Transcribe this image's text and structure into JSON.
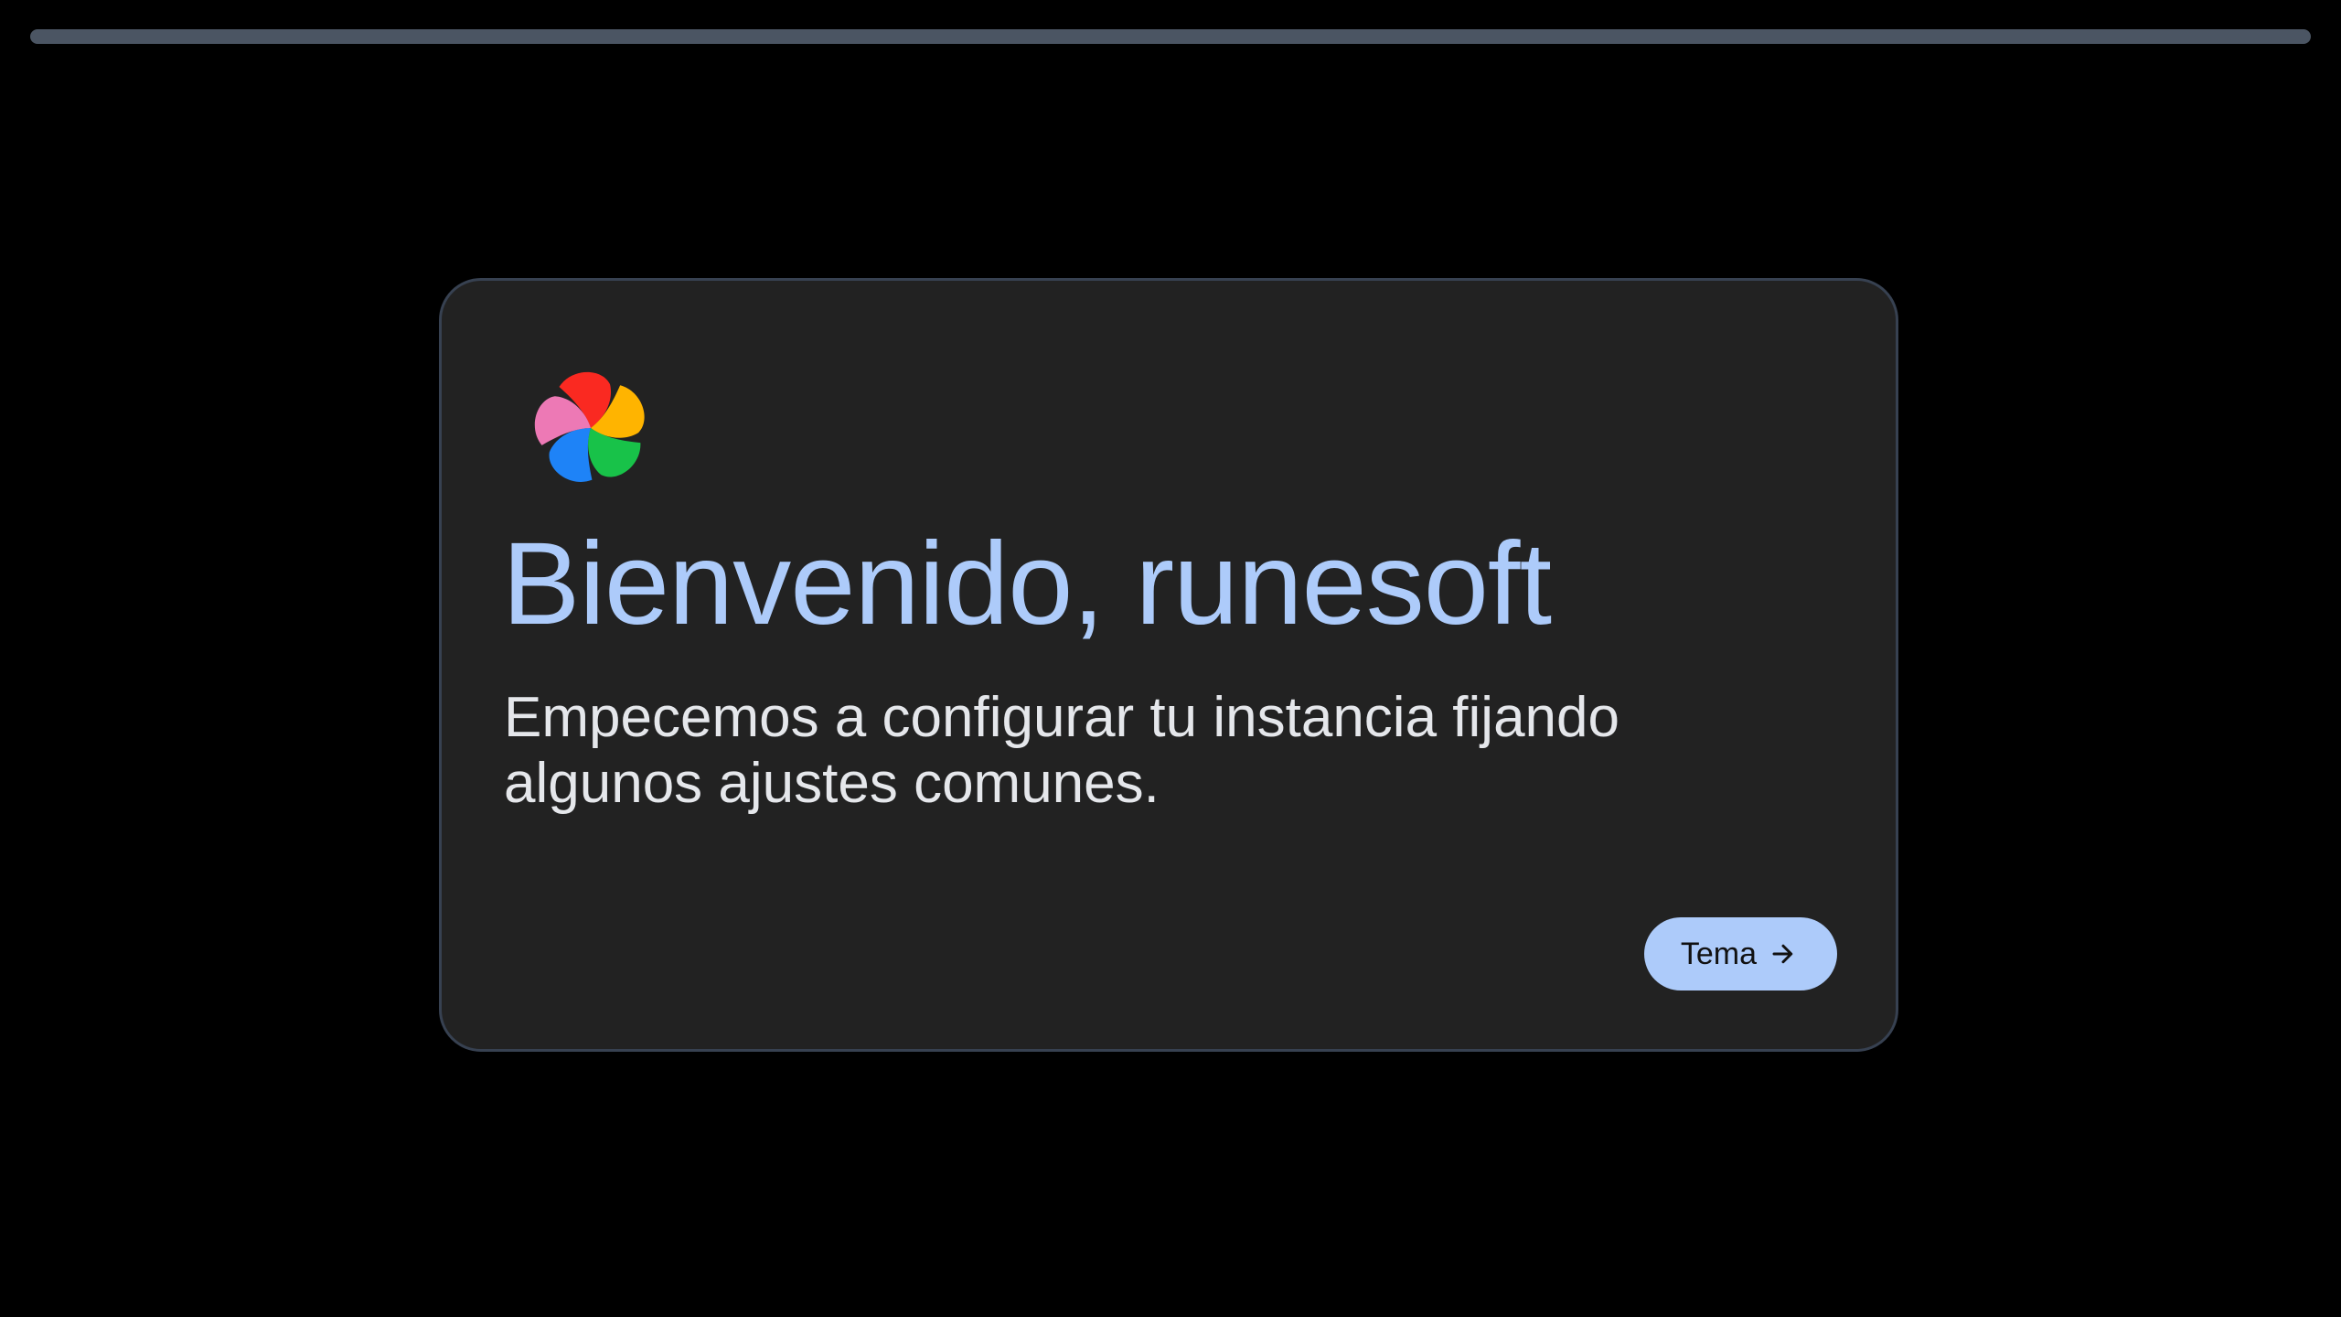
{
  "progress": {
    "value": 0,
    "track_color": "#4b5563"
  },
  "card": {
    "logo_icon": "pinwheel-logo-icon",
    "title": "Bienvenido, runesoft",
    "subtitle": "Empecemos a configurar tu instancia fijando algunos ajustes comunes.",
    "next_button": {
      "label": "Tema",
      "icon": "arrow-right-icon"
    }
  },
  "colors": {
    "background": "#000000",
    "card_background": "#222222",
    "card_border": "#374151",
    "accent": "#adcbfa",
    "button_text": "#111111",
    "logo_red": "#fa2921",
    "logo_yellow": "#ffb400",
    "logo_green": "#18c249",
    "logo_blue": "#1e83f7",
    "logo_pink": "#ed79b5"
  }
}
